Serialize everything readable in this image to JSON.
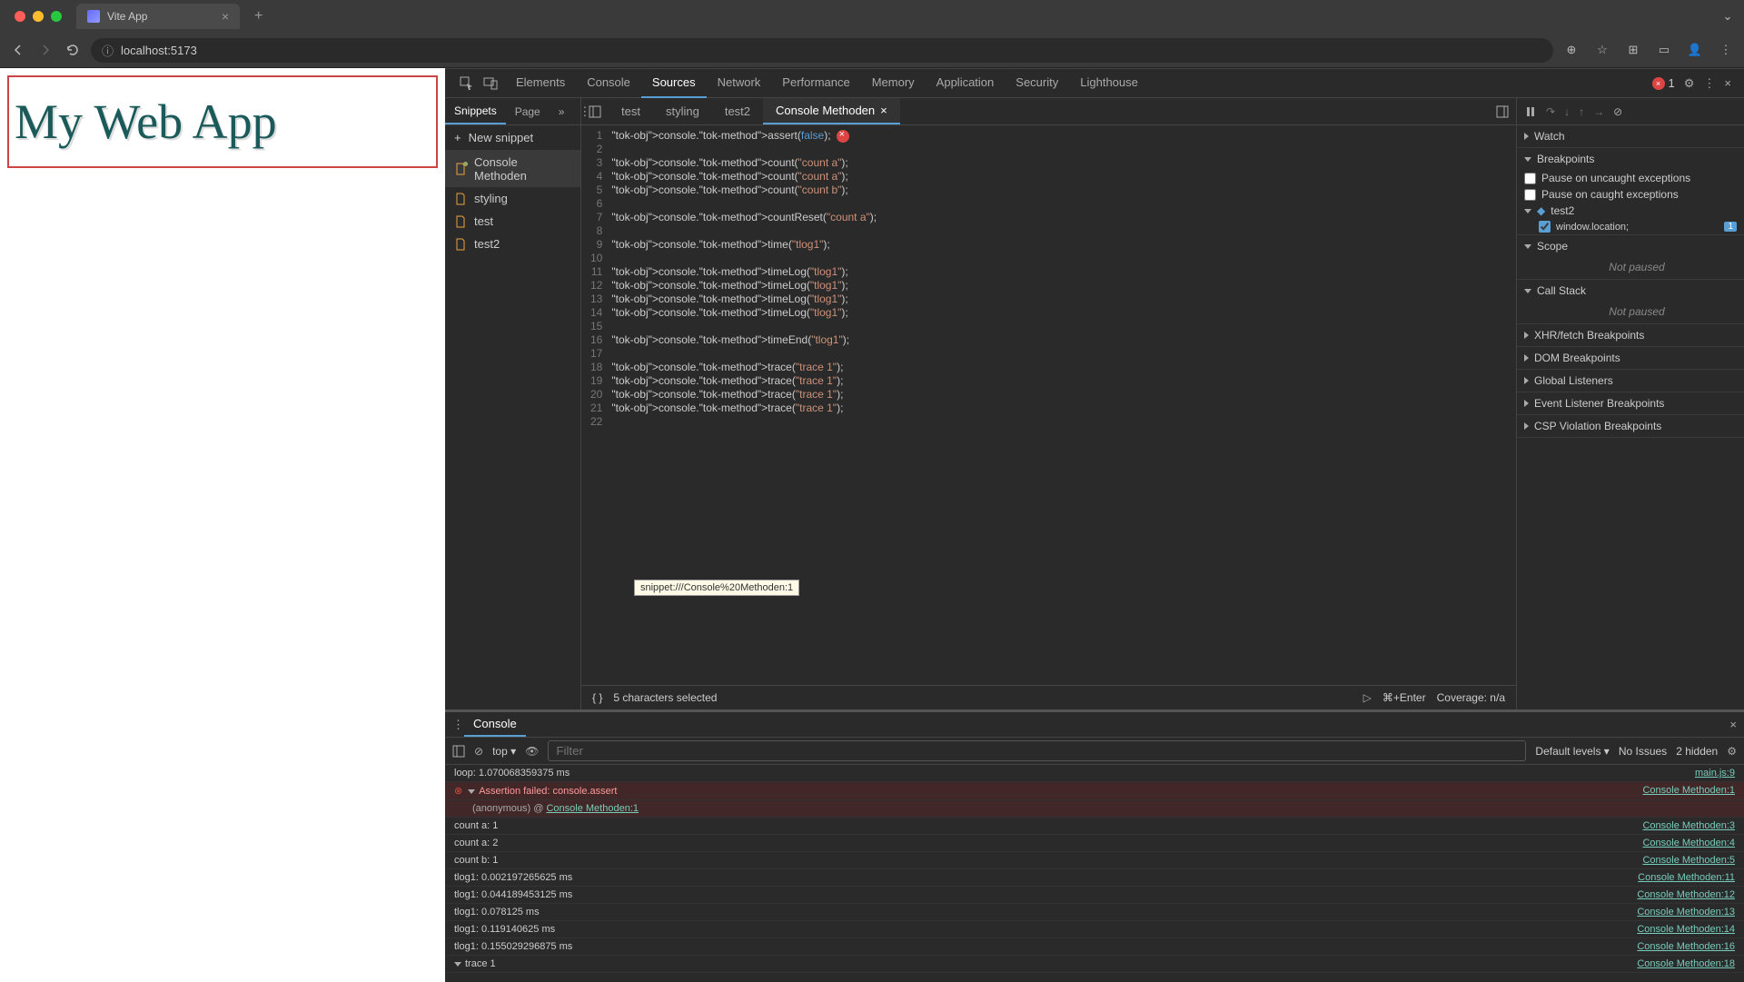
{
  "browser": {
    "tab_title": "Vite App",
    "url": "localhost:5173"
  },
  "webpage": {
    "heading": "My Web App"
  },
  "devtools": {
    "tabs": [
      "Elements",
      "Console",
      "Sources",
      "Network",
      "Performance",
      "Memory",
      "Application",
      "Security",
      "Lighthouse"
    ],
    "active_tab": "Sources",
    "error_count": "1"
  },
  "sources": {
    "sub_tabs": {
      "snippets": "Snippets",
      "page": "Page"
    },
    "new_snippet": "New snippet",
    "snippets": [
      "Console Methoden",
      "styling",
      "test",
      "test2"
    ],
    "file_tabs": [
      "test",
      "styling",
      "test2",
      "Console Methoden"
    ],
    "code": [
      {
        "n": 1,
        "l": "console.assert(false);",
        "err": true
      },
      {
        "n": 2,
        "l": ""
      },
      {
        "n": 3,
        "l": "console.count(\"count a\");"
      },
      {
        "n": 4,
        "l": "console.count(\"count a\");"
      },
      {
        "n": 5,
        "l": "console.count(\"count b\");"
      },
      {
        "n": 6,
        "l": ""
      },
      {
        "n": 7,
        "l": "console.countReset(\"count a\");"
      },
      {
        "n": 8,
        "l": ""
      },
      {
        "n": 9,
        "l": "console.time(\"tlog1\");"
      },
      {
        "n": 10,
        "l": ""
      },
      {
        "n": 11,
        "l": "console.timeLog(\"tlog1\");"
      },
      {
        "n": 12,
        "l": "console.timeLog(\"tlog1\");"
      },
      {
        "n": 13,
        "l": "console.timeLog(\"tlog1\");"
      },
      {
        "n": 14,
        "l": "console.timeLog(\"tlog1\");"
      },
      {
        "n": 15,
        "l": ""
      },
      {
        "n": 16,
        "l": "console.timeEnd(\"tlog1\");"
      },
      {
        "n": 17,
        "l": ""
      },
      {
        "n": 18,
        "l": "console.trace(\"trace 1\");"
      },
      {
        "n": 19,
        "l": "console.trace(\"trace 1\");"
      },
      {
        "n": 20,
        "l": "console.trace(\"trace 1\");"
      },
      {
        "n": 21,
        "l": "console.trace(\"trace 1\");"
      },
      {
        "n": 22,
        "l": ""
      }
    ],
    "status": {
      "selection": "5 characters selected",
      "run_hint": "⌘+Enter",
      "coverage": "Coverage: n/a"
    }
  },
  "debug": {
    "watch": "Watch",
    "breakpoints": "Breakpoints",
    "pause_uncaught": "Pause on uncaught exceptions",
    "pause_caught": "Pause on caught exceptions",
    "bp_file": "test2",
    "bp_expr": "window.location;",
    "bp_line": "1",
    "scope": "Scope",
    "not_paused": "Not paused",
    "call_stack": "Call Stack",
    "xhr": "XHR/fetch Breakpoints",
    "dom": "DOM Breakpoints",
    "global": "Global Listeners",
    "event": "Event Listener Breakpoints",
    "csp": "CSP Violation Breakpoints"
  },
  "console": {
    "drawer_label": "Console",
    "context": "top",
    "filter_placeholder": "Filter",
    "levels": "Default levels",
    "no_issues": "No Issues",
    "hidden": "2 hidden",
    "tooltip": "snippet:///Console%20Methoden:1",
    "messages": [
      {
        "type": "log",
        "text": "loop: 1.070068359375 ms",
        "source": "main.js:9"
      },
      {
        "type": "error",
        "text": "Assertion failed: console.assert",
        "source": "Console Methoden:1",
        "trace": "(anonymous) @ Console Methoden:1"
      },
      {
        "type": "log",
        "text": "count a: 1",
        "source": "Console Methoden:3"
      },
      {
        "type": "log",
        "text": "count a: 2",
        "source": "Console Methoden:4"
      },
      {
        "type": "log",
        "text": "count b: 1",
        "source": "Console Methoden:5"
      },
      {
        "type": "log",
        "text": "tlog1: 0.002197265625 ms",
        "source": "Console Methoden:11"
      },
      {
        "type": "log",
        "text": "tlog1: 0.044189453125 ms",
        "source": "Console Methoden:12"
      },
      {
        "type": "log",
        "text": "tlog1: 0.078125 ms",
        "source": "Console Methoden:13"
      },
      {
        "type": "log",
        "text": "tlog1: 0.119140625 ms",
        "source": "Console Methoden:14"
      },
      {
        "type": "log",
        "text": "tlog1: 0.155029296875 ms",
        "source": "Console Methoden:16"
      },
      {
        "type": "log",
        "text": "trace 1",
        "source": "Console Methoden:18",
        "expand": true
      }
    ]
  }
}
